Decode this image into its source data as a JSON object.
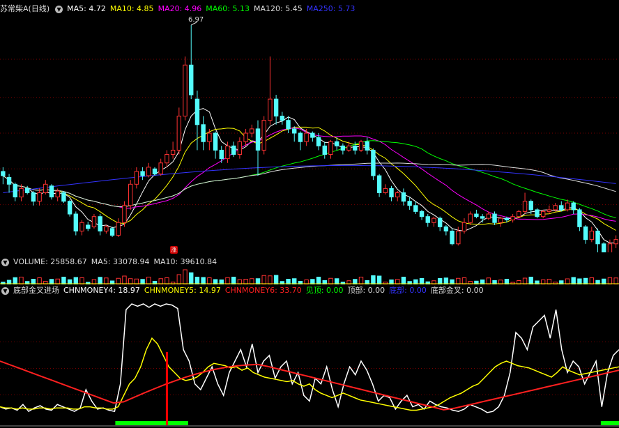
{
  "price_legend": {
    "stock": "苏常柴A",
    "period": "(日线)",
    "items": [
      {
        "label": "MA5: 4.72",
        "color": "#ffffff"
      },
      {
        "label": "MA10: 4.85",
        "color": "#ffff00"
      },
      {
        "label": "MA20: 4.96",
        "color": "#ff00ff"
      },
      {
        "label": "MA60: 5.13",
        "color": "#00ff00"
      },
      {
        "label": "MA120: 5.45",
        "color": "#dddddd"
      },
      {
        "label": "MA250: 5.73",
        "color": "#3333ff"
      }
    ]
  },
  "peak_label": "6.97",
  "rise_badge": "涨",
  "volume_legend": {
    "items": [
      {
        "label": "VOLUME: 25858.67",
        "color": "#dddddd"
      },
      {
        "label": "MA5: 33078.94",
        "color": "#dddddd"
      },
      {
        "label": "MA10: 39610.84",
        "color": "#dddddd"
      }
    ]
  },
  "indicator_legend": {
    "name": "底部金叉进场",
    "items": [
      {
        "label": "CHNMONEY4: 18.97",
        "color": "#ffffff"
      },
      {
        "label": "CHNMONEY5: 14.97",
        "color": "#ffff00"
      },
      {
        "label": "CHNMONEY6: 33.70",
        "color": "#ff2020"
      },
      {
        "label": "见顶: 0.00",
        "color": "#00ff00"
      },
      {
        "label": "顶部: 0.00",
        "color": "#dddddd"
      },
      {
        "label": "底部: 0.00",
        "color": "#3333ff"
      },
      {
        "label": "底部金叉: 0.00",
        "color": "#dddddd"
      }
    ]
  },
  "colors": {
    "up": "#ff3232",
    "down": "#54fcfc",
    "grid": "#7a0000",
    "signal": "#ff0000",
    "bottom_bar": "#00ff00"
  },
  "chart_data": {
    "type": "candlestick",
    "price_range": [
      4.3,
      7.1
    ],
    "candles": [
      [
        5.25,
        5.2,
        5.3,
        5.1
      ],
      [
        5.18,
        5.1,
        5.22,
        5.0
      ],
      [
        5.1,
        4.95,
        5.12,
        4.9
      ],
      [
        4.95,
        5.05,
        5.1,
        4.9
      ],
      [
        5.05,
        5.0,
        5.08,
        4.98
      ],
      [
        5.0,
        4.9,
        5.02,
        4.85
      ],
      [
        4.9,
        5.0,
        5.05,
        4.85
      ],
      [
        5.0,
        5.1,
        5.15,
        4.98
      ],
      [
        5.08,
        4.95,
        5.1,
        4.92
      ],
      [
        4.95,
        5.02,
        5.05,
        4.9
      ],
      [
        5.0,
        4.9,
        5.02,
        4.88
      ],
      [
        4.9,
        4.75,
        4.92,
        4.72
      ],
      [
        4.75,
        4.55,
        4.78,
        4.5
      ],
      [
        4.55,
        4.65,
        4.68,
        4.5
      ],
      [
        4.62,
        4.58,
        4.66,
        4.55
      ],
      [
        4.6,
        4.72,
        4.75,
        4.58
      ],
      [
        4.72,
        4.55,
        4.75,
        4.5
      ],
      [
        4.55,
        4.6,
        4.62,
        4.52
      ],
      [
        4.58,
        4.5,
        4.6,
        4.48
      ],
      [
        4.5,
        4.65,
        4.7,
        4.48
      ],
      [
        4.65,
        4.85,
        4.9,
        4.6
      ],
      [
        4.85,
        5.1,
        5.15,
        4.8
      ],
      [
        5.1,
        5.25,
        5.3,
        5.05
      ],
      [
        5.25,
        5.2,
        5.3,
        5.15
      ],
      [
        5.2,
        5.3,
        5.35,
        5.18
      ],
      [
        5.28,
        5.22,
        5.3,
        5.2
      ],
      [
        5.22,
        5.35,
        5.4,
        5.2
      ],
      [
        5.35,
        5.45,
        5.5,
        5.3
      ],
      [
        5.45,
        5.5,
        5.6,
        5.4
      ],
      [
        5.5,
        5.9,
        6.0,
        5.45
      ],
      [
        5.9,
        6.5,
        6.6,
        5.85
      ],
      [
        6.5,
        6.15,
        6.97,
        6.1
      ],
      [
        6.1,
        5.8,
        6.2,
        5.5
      ],
      [
        5.8,
        5.6,
        5.9,
        5.5
      ],
      [
        5.6,
        5.7,
        5.75,
        5.5
      ],
      [
        5.7,
        5.5,
        5.72,
        5.4
      ],
      [
        5.5,
        5.4,
        5.55,
        5.35
      ],
      [
        5.4,
        5.55,
        5.6,
        5.35
      ],
      [
        5.55,
        5.45,
        5.6,
        5.42
      ],
      [
        5.45,
        5.6,
        5.65,
        5.4
      ],
      [
        5.6,
        5.7,
        5.75,
        5.55
      ],
      [
        5.7,
        5.75,
        5.8,
        5.65
      ],
      [
        5.75,
        5.5,
        5.85,
        5.2
      ],
      [
        5.5,
        5.85,
        5.9,
        5.45
      ],
      [
        5.85,
        6.1,
        6.6,
        5.8
      ],
      [
        6.1,
        5.9,
        6.15,
        5.8
      ],
      [
        5.9,
        5.85,
        5.95,
        5.8
      ],
      [
        5.85,
        5.75,
        5.9,
        5.7
      ],
      [
        5.75,
        5.7,
        5.78,
        5.6
      ],
      [
        5.7,
        5.6,
        5.72,
        5.5
      ],
      [
        5.6,
        5.7,
        5.75,
        5.55
      ],
      [
        5.7,
        5.65,
        5.72,
        5.6
      ],
      [
        5.65,
        5.55,
        5.7,
        5.5
      ],
      [
        5.55,
        5.45,
        5.6,
        5.4
      ],
      [
        5.45,
        5.6,
        5.62,
        5.4
      ],
      [
        5.6,
        5.55,
        5.65,
        5.5
      ],
      [
        5.55,
        5.5,
        5.58,
        5.45
      ],
      [
        5.5,
        5.55,
        5.6,
        5.48
      ],
      [
        5.55,
        5.5,
        5.6,
        5.45
      ],
      [
        5.5,
        5.6,
        5.62,
        5.48
      ],
      [
        5.6,
        5.5,
        5.65,
        5.45
      ],
      [
        5.5,
        5.2,
        5.52,
        5.15
      ],
      [
        5.2,
        5.0,
        5.22,
        4.95
      ],
      [
        5.0,
        5.05,
        5.1,
        4.98
      ],
      [
        5.05,
        4.95,
        5.08,
        4.9
      ],
      [
        4.95,
        5.0,
        5.02,
        4.9
      ],
      [
        5.0,
        4.9,
        5.05,
        4.85
      ],
      [
        4.9,
        4.85,
        4.95,
        4.8
      ],
      [
        4.85,
        4.78,
        4.9,
        4.75
      ],
      [
        4.78,
        4.72,
        4.8,
        4.68
      ],
      [
        4.72,
        4.65,
        4.75,
        4.6
      ],
      [
        4.65,
        4.7,
        4.72,
        4.6
      ],
      [
        4.7,
        4.6,
        4.72,
        4.55
      ],
      [
        4.6,
        4.55,
        4.62,
        4.5
      ],
      [
        4.55,
        4.4,
        4.58,
        4.38
      ],
      [
        4.4,
        4.55,
        4.6,
        4.38
      ],
      [
        4.55,
        4.65,
        4.7,
        4.52
      ],
      [
        4.65,
        4.75,
        4.78,
        4.62
      ],
      [
        4.75,
        4.72,
        4.8,
        4.7
      ],
      [
        4.72,
        4.7,
        4.75,
        4.65
      ],
      [
        4.7,
        4.75,
        4.78,
        4.68
      ],
      [
        4.75,
        4.65,
        4.78,
        4.62
      ],
      [
        4.65,
        4.7,
        4.72,
        4.6
      ],
      [
        4.7,
        4.68,
        4.72,
        4.65
      ],
      [
        4.68,
        4.72,
        4.75,
        4.65
      ],
      [
        4.72,
        4.78,
        4.8,
        4.7
      ],
      [
        4.78,
        4.9,
        5.0,
        4.75
      ],
      [
        4.9,
        4.8,
        4.92,
        4.75
      ],
      [
        4.8,
        4.72,
        4.82,
        4.7
      ],
      [
        4.72,
        4.78,
        4.8,
        4.7
      ],
      [
        4.78,
        4.8,
        4.85,
        4.75
      ],
      [
        4.8,
        4.85,
        4.88,
        4.78
      ],
      [
        4.85,
        4.8,
        4.9,
        4.78
      ],
      [
        4.8,
        4.88,
        4.92,
        4.78
      ],
      [
        4.88,
        4.8,
        4.9,
        4.75
      ],
      [
        4.8,
        4.6,
        4.82,
        4.55
      ],
      [
        4.6,
        4.45,
        4.62,
        4.4
      ],
      [
        4.45,
        4.55,
        4.6,
        4.42
      ],
      [
        4.55,
        4.4,
        4.58,
        4.3
      ],
      [
        4.4,
        4.25,
        4.42,
        4.2
      ],
      [
        4.25,
        4.4,
        4.45,
        4.22
      ],
      [
        4.4,
        4.45,
        4.5,
        4.35
      ]
    ],
    "indicator": {
      "range": [
        0,
        100
      ],
      "signals": [
        27,
        106
      ],
      "bottom_zones": [
        [
          19,
          31
        ],
        [
          99,
          109
        ]
      ],
      "white": [
        10,
        8,
        9,
        7,
        12,
        6,
        9,
        11,
        8,
        7,
        12,
        10,
        8,
        6,
        9,
        25,
        15,
        8,
        9,
        7,
        6,
        30,
        95,
        100,
        98,
        100,
        97,
        100,
        98,
        100,
        99,
        96,
        60,
        50,
        30,
        25,
        35,
        45,
        30,
        20,
        40,
        50,
        60,
        45,
        65,
        40,
        50,
        55,
        35,
        45,
        50,
        30,
        40,
        20,
        15,
        35,
        30,
        45,
        25,
        10,
        30,
        45,
        38,
        50,
        42,
        30,
        15,
        20,
        18,
        8,
        15,
        20,
        10,
        12,
        8,
        15,
        12,
        10,
        9,
        7,
        6,
        8,
        12,
        10,
        8,
        5,
        6,
        10,
        20,
        40,
        75,
        70,
        60,
        80,
        85,
        90,
        70,
        95,
        60,
        40,
        50,
        45,
        30,
        40,
        50,
        10,
        40,
        55,
        60
      ],
      "yellow": [
        10,
        9,
        9,
        8,
        9,
        8,
        8,
        9,
        9,
        8,
        9,
        9,
        9,
        8,
        8,
        10,
        10,
        9,
        9,
        8,
        8,
        10,
        20,
        30,
        35,
        45,
        60,
        70,
        65,
        55,
        45,
        40,
        35,
        33,
        34,
        36,
        40,
        45,
        48,
        47,
        46,
        44,
        45,
        42,
        44,
        40,
        38,
        36,
        35,
        34,
        33,
        32,
        33,
        30,
        28,
        30,
        25,
        22,
        20,
        18,
        20,
        22,
        20,
        18,
        16,
        15,
        14,
        13,
        12,
        11,
        10,
        9,
        8,
        7,
        7,
        8,
        9,
        10,
        12,
        15,
        18,
        20,
        22,
        25,
        28,
        30,
        35,
        40,
        45,
        48,
        50,
        48,
        46,
        45,
        44,
        42,
        40,
        38,
        36,
        40,
        45,
        42,
        40,
        38,
        39,
        40,
        41,
        42,
        43,
        44,
        45
      ]
    }
  }
}
